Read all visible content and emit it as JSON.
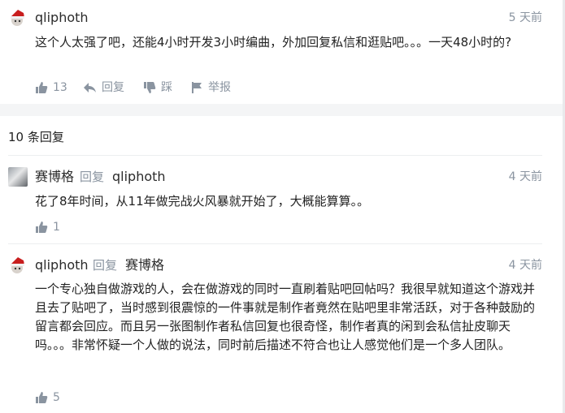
{
  "main_post": {
    "username": "qliphoth",
    "time": "5 天前",
    "text": "这个人太强了吧，还能4小时开发3小时编曲，外加回复私信和逛贴吧。。。一天48小时的?",
    "like_count": "13",
    "reply_label": "回复",
    "dislike_label": "踩",
    "report_label": "举报"
  },
  "replies_header": {
    "count_text": "10 条回复"
  },
  "replies": [
    {
      "username": "赛博格",
      "reply_word": "回复",
      "reply_to": "qliphoth",
      "time": "4 天前",
      "text": "花了8年时间，从11年做完战火风暴就开始了，大概能算算。。",
      "like_count": "1"
    },
    {
      "username": "qliphoth",
      "reply_word": "回复",
      "reply_to": "赛博格",
      "time": "4 天前",
      "text": "一个专心独自做游戏的人，会在做游戏的同时一直刷着贴吧回帖吗？我很早就知道这个游戏并且去了贴吧了，当时感到很震惊的一件事就是制作者竟然在贴吧里非常活跃，对于各种鼓励的留言都会回应。而且另一张图制作者私信回复也很奇怪，制作者真的闲到会私信扯皮聊天吗。。。非常怀疑一个人做的说法，同时前后描述不符合也让人感觉他们是一个多人团队。",
      "like_count": "5"
    }
  ],
  "icons": {
    "like": "thumbs-up-icon",
    "reply": "reply-arrow-icon",
    "dislike": "thumbs-down-icon",
    "report": "flag-icon"
  },
  "colors": {
    "meta_gray": "#8a94a0",
    "text": "#222222",
    "section_gap": "#f4f5f6"
  }
}
